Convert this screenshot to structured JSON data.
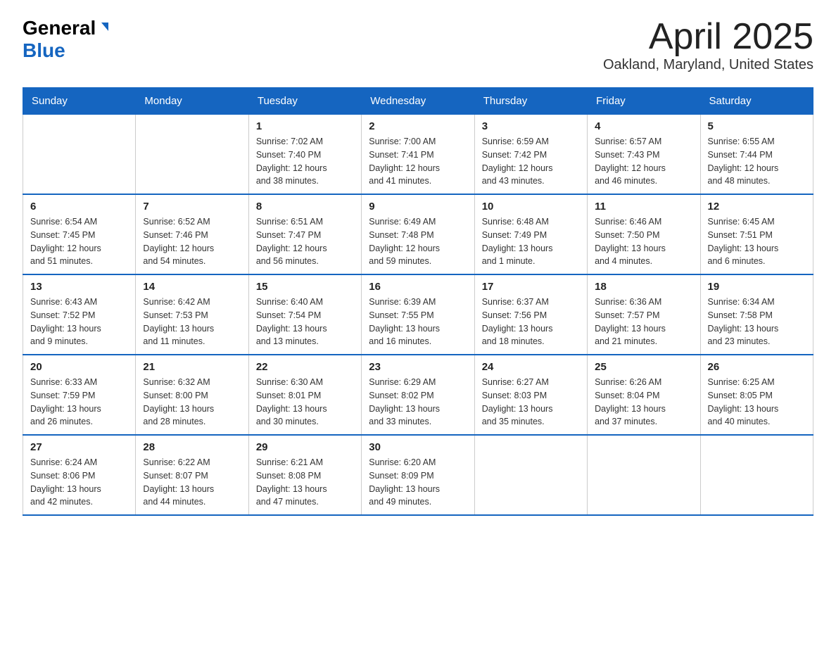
{
  "header": {
    "logo_general": "General",
    "logo_blue": "Blue",
    "title": "April 2025",
    "subtitle": "Oakland, Maryland, United States"
  },
  "days_of_week": [
    "Sunday",
    "Monday",
    "Tuesday",
    "Wednesday",
    "Thursday",
    "Friday",
    "Saturday"
  ],
  "weeks": [
    [
      {
        "day": "",
        "info": ""
      },
      {
        "day": "",
        "info": ""
      },
      {
        "day": "1",
        "info": "Sunrise: 7:02 AM\nSunset: 7:40 PM\nDaylight: 12 hours\nand 38 minutes."
      },
      {
        "day": "2",
        "info": "Sunrise: 7:00 AM\nSunset: 7:41 PM\nDaylight: 12 hours\nand 41 minutes."
      },
      {
        "day": "3",
        "info": "Sunrise: 6:59 AM\nSunset: 7:42 PM\nDaylight: 12 hours\nand 43 minutes."
      },
      {
        "day": "4",
        "info": "Sunrise: 6:57 AM\nSunset: 7:43 PM\nDaylight: 12 hours\nand 46 minutes."
      },
      {
        "day": "5",
        "info": "Sunrise: 6:55 AM\nSunset: 7:44 PM\nDaylight: 12 hours\nand 48 minutes."
      }
    ],
    [
      {
        "day": "6",
        "info": "Sunrise: 6:54 AM\nSunset: 7:45 PM\nDaylight: 12 hours\nand 51 minutes."
      },
      {
        "day": "7",
        "info": "Sunrise: 6:52 AM\nSunset: 7:46 PM\nDaylight: 12 hours\nand 54 minutes."
      },
      {
        "day": "8",
        "info": "Sunrise: 6:51 AM\nSunset: 7:47 PM\nDaylight: 12 hours\nand 56 minutes."
      },
      {
        "day": "9",
        "info": "Sunrise: 6:49 AM\nSunset: 7:48 PM\nDaylight: 12 hours\nand 59 minutes."
      },
      {
        "day": "10",
        "info": "Sunrise: 6:48 AM\nSunset: 7:49 PM\nDaylight: 13 hours\nand 1 minute."
      },
      {
        "day": "11",
        "info": "Sunrise: 6:46 AM\nSunset: 7:50 PM\nDaylight: 13 hours\nand 4 minutes."
      },
      {
        "day": "12",
        "info": "Sunrise: 6:45 AM\nSunset: 7:51 PM\nDaylight: 13 hours\nand 6 minutes."
      }
    ],
    [
      {
        "day": "13",
        "info": "Sunrise: 6:43 AM\nSunset: 7:52 PM\nDaylight: 13 hours\nand 9 minutes."
      },
      {
        "day": "14",
        "info": "Sunrise: 6:42 AM\nSunset: 7:53 PM\nDaylight: 13 hours\nand 11 minutes."
      },
      {
        "day": "15",
        "info": "Sunrise: 6:40 AM\nSunset: 7:54 PM\nDaylight: 13 hours\nand 13 minutes."
      },
      {
        "day": "16",
        "info": "Sunrise: 6:39 AM\nSunset: 7:55 PM\nDaylight: 13 hours\nand 16 minutes."
      },
      {
        "day": "17",
        "info": "Sunrise: 6:37 AM\nSunset: 7:56 PM\nDaylight: 13 hours\nand 18 minutes."
      },
      {
        "day": "18",
        "info": "Sunrise: 6:36 AM\nSunset: 7:57 PM\nDaylight: 13 hours\nand 21 minutes."
      },
      {
        "day": "19",
        "info": "Sunrise: 6:34 AM\nSunset: 7:58 PM\nDaylight: 13 hours\nand 23 minutes."
      }
    ],
    [
      {
        "day": "20",
        "info": "Sunrise: 6:33 AM\nSunset: 7:59 PM\nDaylight: 13 hours\nand 26 minutes."
      },
      {
        "day": "21",
        "info": "Sunrise: 6:32 AM\nSunset: 8:00 PM\nDaylight: 13 hours\nand 28 minutes."
      },
      {
        "day": "22",
        "info": "Sunrise: 6:30 AM\nSunset: 8:01 PM\nDaylight: 13 hours\nand 30 minutes."
      },
      {
        "day": "23",
        "info": "Sunrise: 6:29 AM\nSunset: 8:02 PM\nDaylight: 13 hours\nand 33 minutes."
      },
      {
        "day": "24",
        "info": "Sunrise: 6:27 AM\nSunset: 8:03 PM\nDaylight: 13 hours\nand 35 minutes."
      },
      {
        "day": "25",
        "info": "Sunrise: 6:26 AM\nSunset: 8:04 PM\nDaylight: 13 hours\nand 37 minutes."
      },
      {
        "day": "26",
        "info": "Sunrise: 6:25 AM\nSunset: 8:05 PM\nDaylight: 13 hours\nand 40 minutes."
      }
    ],
    [
      {
        "day": "27",
        "info": "Sunrise: 6:24 AM\nSunset: 8:06 PM\nDaylight: 13 hours\nand 42 minutes."
      },
      {
        "day": "28",
        "info": "Sunrise: 6:22 AM\nSunset: 8:07 PM\nDaylight: 13 hours\nand 44 minutes."
      },
      {
        "day": "29",
        "info": "Sunrise: 6:21 AM\nSunset: 8:08 PM\nDaylight: 13 hours\nand 47 minutes."
      },
      {
        "day": "30",
        "info": "Sunrise: 6:20 AM\nSunset: 8:09 PM\nDaylight: 13 hours\nand 49 minutes."
      },
      {
        "day": "",
        "info": ""
      },
      {
        "day": "",
        "info": ""
      },
      {
        "day": "",
        "info": ""
      }
    ]
  ]
}
